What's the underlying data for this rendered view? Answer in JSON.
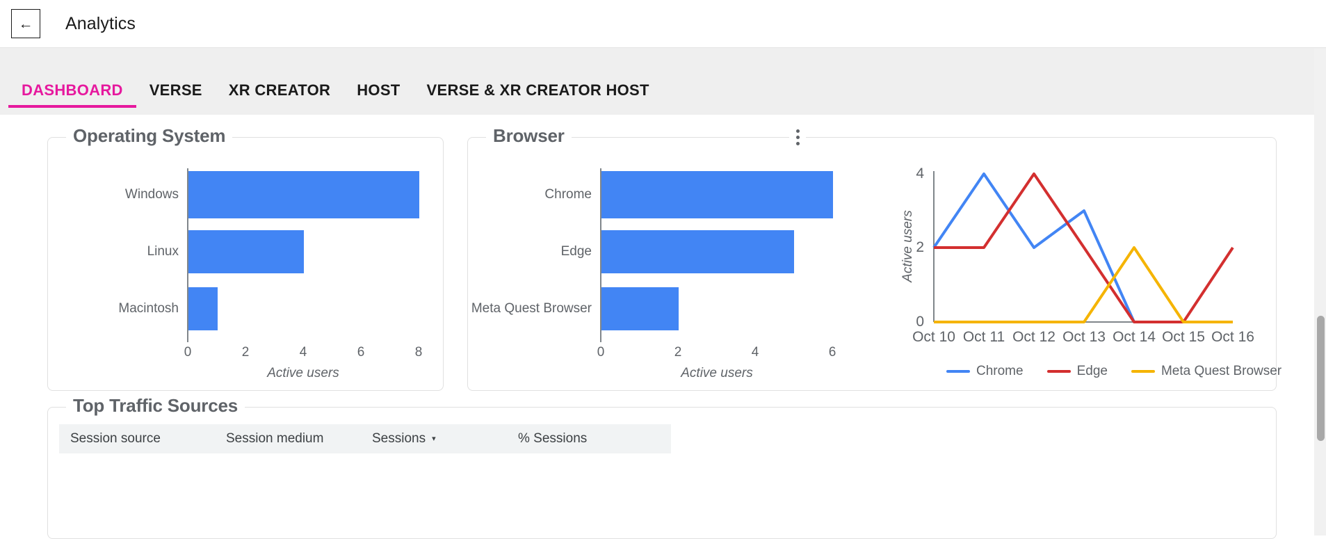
{
  "header": {
    "back_icon": "arrow-left-icon",
    "back_glyph": "←",
    "title": "Analytics"
  },
  "tabs": {
    "active_color": "#e6199e",
    "items": [
      {
        "label": "DASHBOARD",
        "active": true
      },
      {
        "label": "VERSE",
        "active": false
      },
      {
        "label": "XR CREATOR",
        "active": false
      },
      {
        "label": "HOST",
        "active": false
      },
      {
        "label": "VERSE & XR CREATOR HOST",
        "active": false
      }
    ]
  },
  "cards": {
    "os": {
      "title": "Operating System"
    },
    "browser": {
      "title": "Browser",
      "menu_icon": "more-vertical-icon"
    },
    "traffic": {
      "title": "Top Traffic Sources"
    }
  },
  "table": {
    "columns": [
      {
        "label": "Session source",
        "sorted": false
      },
      {
        "label": "Session medium",
        "sorted": false
      },
      {
        "label": "Sessions",
        "sorted": true,
        "sort_caret": "▾"
      },
      {
        "label": "% Sessions",
        "sorted": false
      }
    ]
  },
  "chart_data": [
    {
      "type": "bar",
      "orientation": "horizontal",
      "title": "Operating System",
      "categories": [
        "Windows",
        "Linux",
        "Macintosh"
      ],
      "values": [
        8,
        4,
        1
      ],
      "xlabel": "Active users",
      "ylabel": "",
      "xlim": [
        0,
        8
      ],
      "xticks": [
        0,
        2,
        4,
        6,
        8
      ],
      "bar_color": "#4285f4",
      "grid": false
    },
    {
      "type": "bar",
      "orientation": "horizontal",
      "title": "Browser",
      "categories": [
        "Chrome",
        "Edge",
        "Meta Quest Browser"
      ],
      "values": [
        6,
        5,
        2
      ],
      "xlabel": "Active users",
      "ylabel": "",
      "xlim": [
        0,
        6
      ],
      "xticks": [
        0,
        2,
        4,
        6
      ],
      "bar_color": "#4285f4",
      "grid": false
    },
    {
      "type": "line",
      "title": "",
      "x": [
        "Oct 10",
        "Oct 11",
        "Oct 12",
        "Oct 13",
        "Oct 14",
        "Oct 15",
        "Oct 16"
      ],
      "series": [
        {
          "name": "Chrome",
          "color": "#4285f4",
          "values": [
            2,
            4,
            2,
            3,
            0,
            0,
            0
          ]
        },
        {
          "name": "Edge",
          "color": "#d32f2f",
          "values": [
            2,
            2,
            4,
            2,
            0,
            0,
            2
          ]
        },
        {
          "name": "Meta Quest Browser",
          "color": "#f5b400",
          "values": [
            0,
            0,
            0,
            0,
            2,
            0,
            0
          ]
        }
      ],
      "xlabel": "",
      "ylabel": "Active users",
      "ylim": [
        0,
        4
      ],
      "yticks": [
        0,
        2,
        4
      ],
      "grid": false,
      "legend_position": "bottom"
    }
  ]
}
